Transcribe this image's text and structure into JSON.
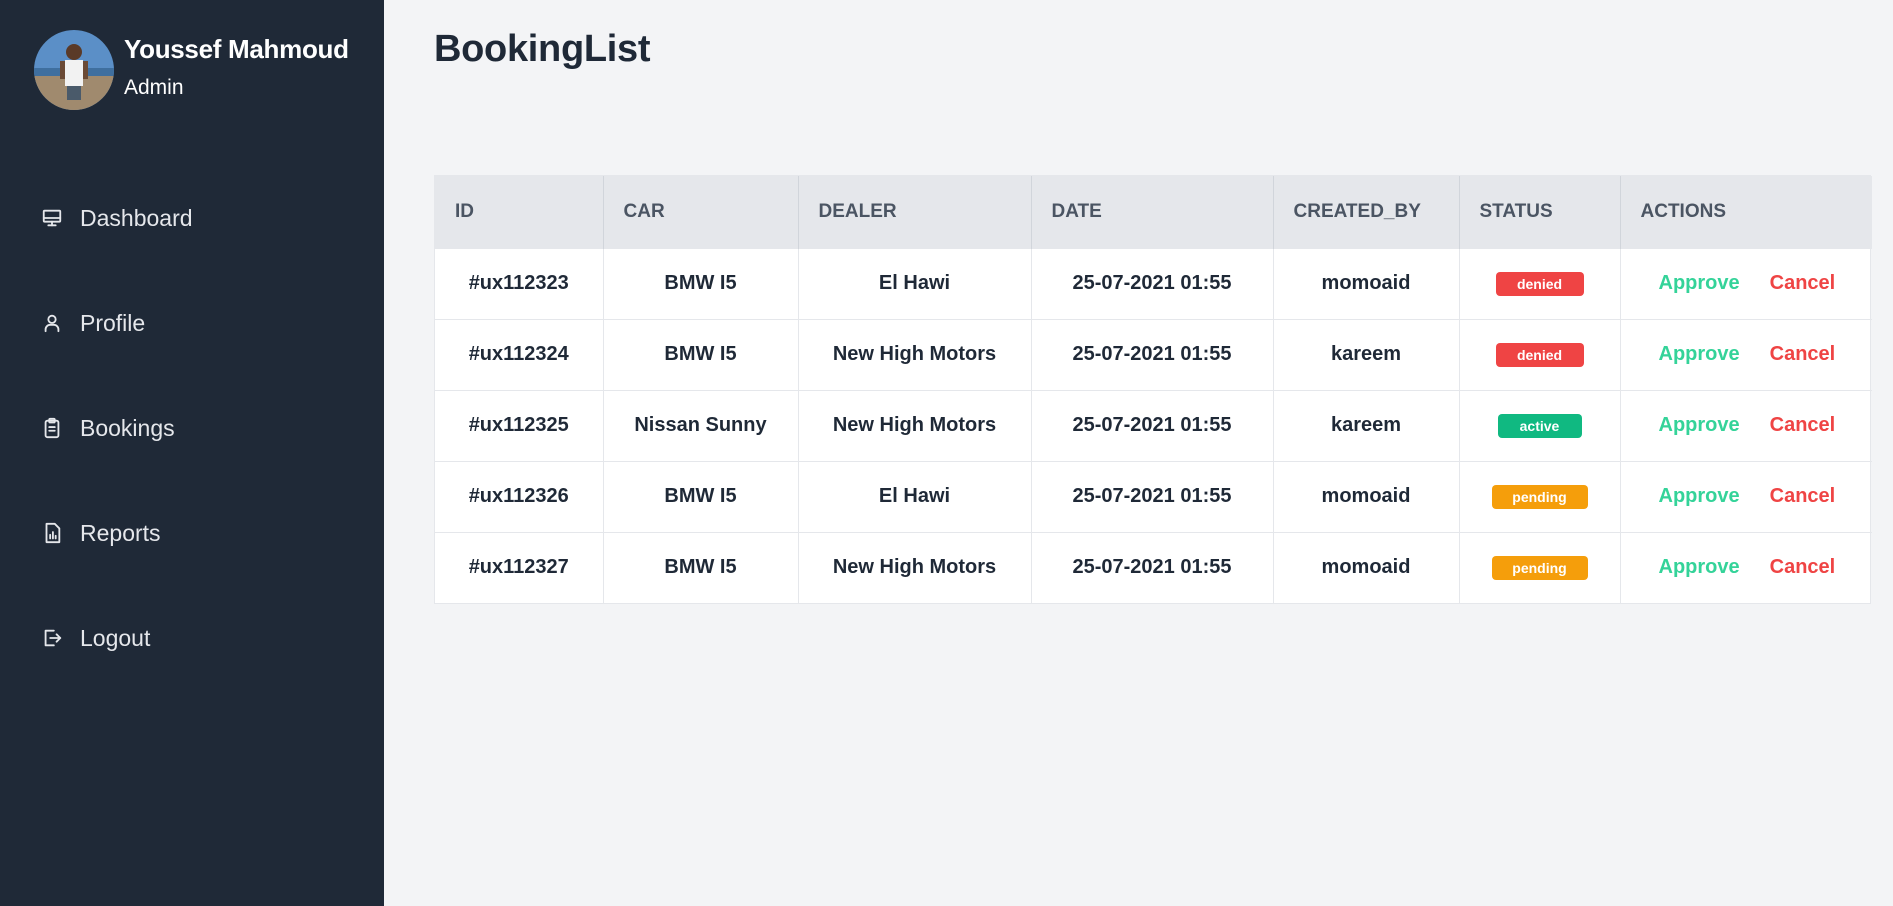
{
  "user": {
    "name": "Youssef Mahmoud",
    "role": "Admin"
  },
  "nav": [
    {
      "label": "Dashboard",
      "icon": "monitor-icon"
    },
    {
      "label": "Profile",
      "icon": "user-icon"
    },
    {
      "label": "Bookings",
      "icon": "clipboard-icon"
    },
    {
      "label": "Reports",
      "icon": "report-icon"
    },
    {
      "label": "Logout",
      "icon": "logout-icon"
    }
  ],
  "page": {
    "title": "BookingList"
  },
  "table": {
    "columns": [
      "ID",
      "CAR",
      "DEALER",
      "DATE",
      "CREATED_BY",
      "STATUS",
      "ACTIONS"
    ],
    "rows": [
      {
        "id": "#ux112323",
        "car": "BMW I5",
        "dealer": "El Hawi",
        "date": "25-07-2021 01:55",
        "created_by": "momoaid",
        "status": "denied",
        "approve": "Approve",
        "cancel": "Cancel"
      },
      {
        "id": "#ux112324",
        "car": "BMW I5",
        "dealer": "New High Motors",
        "date": "25-07-2021 01:55",
        "created_by": "kareem",
        "status": "denied",
        "approve": "Approve",
        "cancel": "Cancel"
      },
      {
        "id": "#ux112325",
        "car": "Nissan Sunny",
        "dealer": "New High Motors",
        "date": "25-07-2021 01:55",
        "created_by": "kareem",
        "status": "active",
        "approve": "Approve",
        "cancel": "Cancel"
      },
      {
        "id": "#ux112326",
        "car": "BMW I5",
        "dealer": "El Hawi",
        "date": "25-07-2021 01:55",
        "created_by": "momoaid",
        "status": "pending",
        "approve": "Approve",
        "cancel": "Cancel"
      },
      {
        "id": "#ux112327",
        "car": "BMW I5",
        "dealer": "New High Motors",
        "date": "25-07-2021 01:55",
        "created_by": "momoaid",
        "status": "pending",
        "approve": "Approve",
        "cancel": "Cancel"
      }
    ]
  },
  "colors": {
    "sidebar": "#1f2937",
    "background": "#f3f4f6",
    "denied": "#ef4444",
    "active": "#10b981",
    "pending": "#f59e0b",
    "approve": "#34d399",
    "cancel": "#ef4444"
  }
}
